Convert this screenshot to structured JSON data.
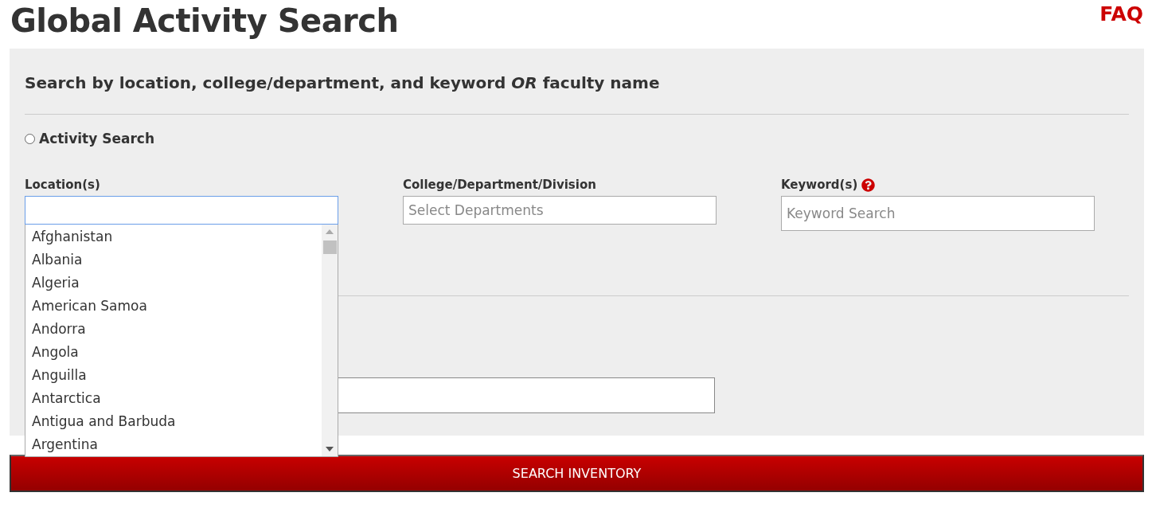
{
  "title": "Global Activity Search",
  "faq_link": "FAQ",
  "panel": {
    "heading": "Search by location, college/department, and keyword *OR* faculty name",
    "activity_search": {
      "label": "Activity Search",
      "checked": false
    },
    "fields": [
      {
        "label": "Location(s)",
        "focused": true,
        "help": false
      },
      {
        "label": "College/Department/Division",
        "placeholder": "Select Departments",
        "focused": false,
        "help": false
      },
      {
        "label": "Keyword(s)",
        "placeholder": "Keyword Search",
        "focused": false,
        "help": true
      }
    ],
    "location_options": [
      "Afghanistan",
      "Albania",
      "Algeria",
      "American Samoa",
      "Andorra",
      "Angola",
      "Anguilla",
      "Antarctica",
      "Antigua and Barbuda",
      "Argentina"
    ]
  },
  "submit_button": "SEARCH INVENTORY"
}
